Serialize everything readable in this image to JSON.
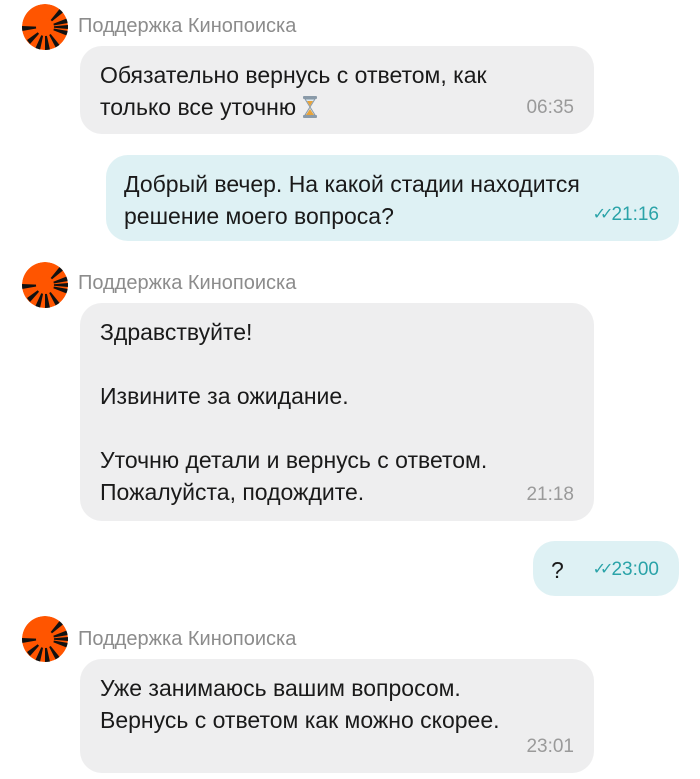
{
  "chat": {
    "sender_name": "Поддержка Кинопоиска",
    "messages": [
      {
        "direction": "incoming",
        "lines": [
          "Обязательно вернусь с ответом, как",
          "только все уточню"
        ],
        "emoji": "hourglass-icon",
        "time": "06:35"
      },
      {
        "direction": "outgoing",
        "lines": [
          "Добрый вечер. На какой стадии находится",
          "решение моего вопроса?"
        ],
        "read_icon": "double-check-icon",
        "time": "21:16"
      },
      {
        "direction": "incoming",
        "lines": [
          "Здравствуйте!",
          "Извините за ожидание.",
          "Уточню детали и вернусь с ответом.",
          "Пожалуйста, подождите."
        ],
        "time": "21:18"
      },
      {
        "direction": "outgoing",
        "lines": [
          "?"
        ],
        "read_icon": "double-check-icon",
        "time": "23:00"
      },
      {
        "direction": "incoming",
        "lines": [
          "Уже занимаюсь вашим вопросом.",
          "Вернусь с ответом как можно скорее."
        ],
        "time": "23:01"
      }
    ]
  },
  "colors": {
    "incoming_bubble": "#eeeeef",
    "outgoing_bubble": "#def1f4",
    "outgoing_time": "#2aa3a8",
    "incoming_time": "#9a9a9a",
    "sender_name": "#8c8c8c",
    "avatar_orange": "#ff5500"
  }
}
